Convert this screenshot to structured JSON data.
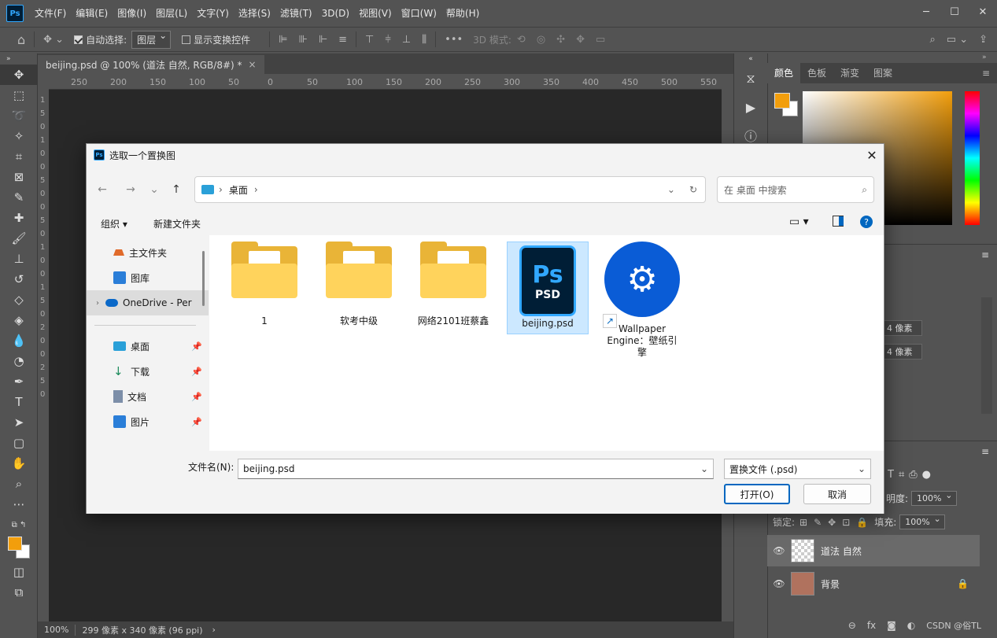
{
  "app": {
    "logo": "Ps",
    "menu": [
      "文件(F)",
      "编辑(E)",
      "图像(I)",
      "图层(L)",
      "文字(Y)",
      "选择(S)",
      "滤镜(T)",
      "3D(D)",
      "视图(V)",
      "窗口(W)",
      "帮助(H)"
    ],
    "window_controls": [
      "─",
      "☐",
      "✕"
    ]
  },
  "options": {
    "auto_select_label": "自动选择:",
    "auto_select_value": "图层",
    "show_transform_label": "显示变换控件",
    "mode_3d_label": "3D 模式:",
    "more": "•••"
  },
  "document": {
    "tab_title": "beijing.psd @ 100% (道法 自然, RGB/8#) *",
    "tab_close": "×",
    "zoom": "100%",
    "size_info": "299 像素 x 340 像素 (96 ppi)",
    "status_arrow": "›"
  },
  "ruler": {
    "h_ticks": [
      "250",
      "200",
      "150",
      "100",
      "50",
      "0",
      "50",
      "100",
      "150",
      "200",
      "250",
      "300",
      "350",
      "400",
      "450",
      "500",
      "550"
    ],
    "v_ticks": [
      "1",
      "5",
      "0",
      "1",
      "0",
      "0",
      "5",
      "0",
      "0",
      "5",
      "0",
      "1",
      "0",
      "0",
      "1",
      "5",
      "0",
      "2",
      "0",
      "0",
      "2",
      "5",
      "0"
    ]
  },
  "panels": {
    "color_tabs": [
      "颜色",
      "色板",
      "渐变",
      "图案"
    ],
    "fg_color": "#f29e0c",
    "bg_color": "#ffffff",
    "props_w": "4 像素",
    "props_h": "4 像素",
    "opacity_label": "明度:",
    "opacity_value": "100%",
    "lock_label": "锁定:",
    "fill_label": "填充:",
    "fill_value": "100%",
    "layers": [
      {
        "name": "道法 自然",
        "locked": false
      },
      {
        "name": "背景",
        "locked": true
      }
    ],
    "watermark": "CSDN @俗TL"
  },
  "dialog": {
    "title": "选取一个置换图",
    "close": "✕",
    "address": {
      "path_root": "桌面",
      "sep": "›"
    },
    "search_placeholder": "在 桌面 中搜索",
    "cmd": {
      "organize": "组织 ▾",
      "new_folder": "新建文件夹",
      "help": "?"
    },
    "sidebar": [
      {
        "label": "主文件夹",
        "icon": "home-icon",
        "pin": false
      },
      {
        "label": "图库",
        "icon": "gallery-icon",
        "pin": false
      },
      {
        "label": "OneDrive - Per",
        "icon": "cloud-icon",
        "pin": false
      },
      {
        "label": "桌面",
        "icon": "desktop-icon",
        "pin": true
      },
      {
        "label": "下载",
        "icon": "download-icon",
        "pin": true
      },
      {
        "label": "文档",
        "icon": "document-icon",
        "pin": true
      },
      {
        "label": "图片",
        "icon": "pictures-icon",
        "pin": true
      }
    ],
    "files": [
      {
        "name": "1",
        "type": "folder"
      },
      {
        "name": "软考中级",
        "type": "folder"
      },
      {
        "name": "网络2101班蔡鑫",
        "type": "folder"
      },
      {
        "name": "beijing.psd",
        "type": "psd",
        "ps_text": "Ps",
        "psd_text": "PSD"
      },
      {
        "name": "Wallpaper Engine：壁纸引擎",
        "type": "shortcut"
      }
    ],
    "filename_label": "文件名(N):",
    "filename_value": "beijing.psd",
    "filetype_value": "置换文件 (.psd)",
    "open_button": "打开(O)",
    "cancel_button": "取消"
  }
}
